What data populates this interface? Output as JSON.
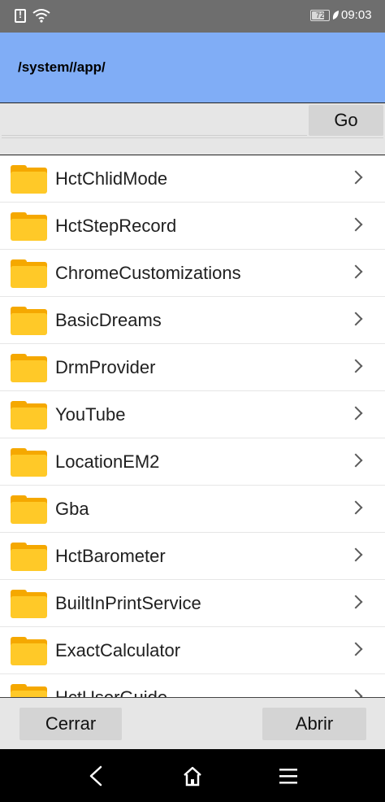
{
  "status_bar": {
    "battery": "72",
    "time": "09:03"
  },
  "path": "/system//app/",
  "input": {
    "value": "",
    "go_label": "Go"
  },
  "items": [
    "HctChlidMode",
    "HctStepRecord",
    "ChromeCustomizations",
    "BasicDreams",
    "DrmProvider",
    "YouTube",
    "LocationEM2",
    "Gba",
    "HctBarometer",
    "BuiltInPrintService",
    "ExactCalculator",
    "HctUserGuide"
  ],
  "actions": {
    "close_label": "Cerrar",
    "open_label": "Abrir"
  },
  "icons": {
    "folder": "folder-icon",
    "chevron": "chevron-right-icon",
    "nav_back": "back-icon",
    "nav_home": "home-icon",
    "nav_menu": "menu-icon"
  },
  "colors": {
    "header": "#80adf6",
    "folder": "#ffc928",
    "status_bar": "#6e6e6e",
    "nav_bar": "#000000"
  }
}
